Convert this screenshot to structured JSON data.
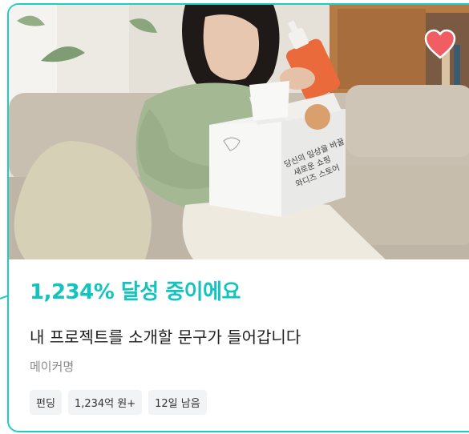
{
  "card": {
    "achievement": "1,234% 달성 중이에요",
    "title": "내 프로젝트를 소개할 문구가 들어갑니다",
    "maker": "메이커명",
    "tags": [
      "펀딩",
      "1,234억 원+",
      "12일 남음"
    ]
  },
  "photo": {
    "box_lines": [
      "당신의 일상을 바꿀",
      "새로운 쇼핑",
      "와디즈 스토어"
    ]
  },
  "colors": {
    "accent": "#12c4bd",
    "border": "#1ccdc6",
    "heart": "#f05e63",
    "tag_bg": "#f2f3f5"
  },
  "icons": {
    "like": "heart-icon"
  }
}
